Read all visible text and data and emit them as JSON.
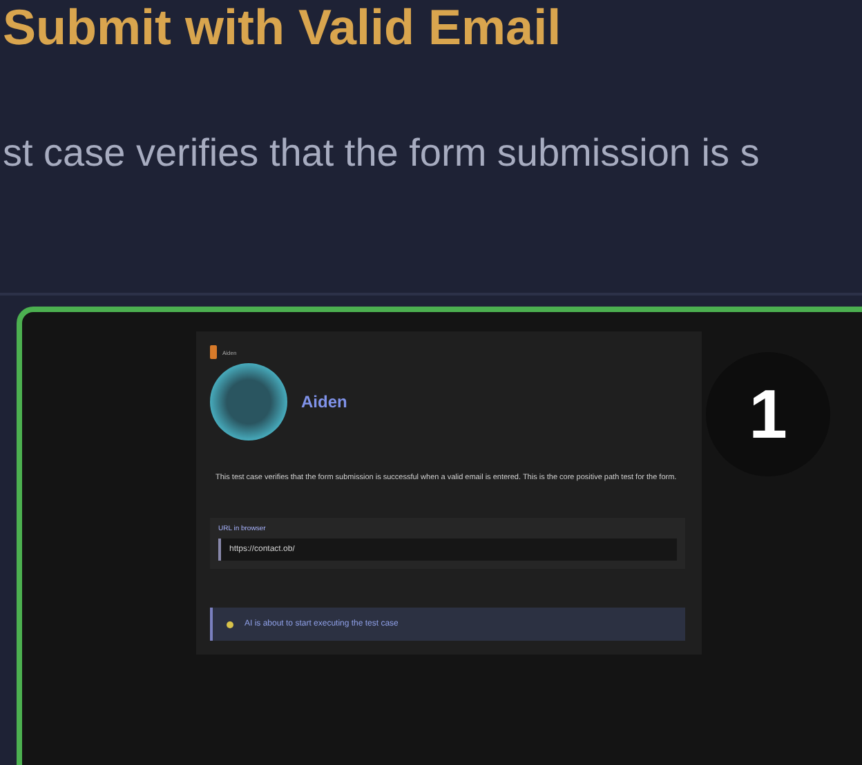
{
  "header": {
    "title": "Submit with Valid Email",
    "description": "st case verifies that the form submission is s"
  },
  "preview": {
    "highlighted": true,
    "step_number": "1",
    "card": {
      "brand": "Aiden",
      "agent_name": "Aiden",
      "description": "This test case verifies that the form submission is successful when a valid email is entered. This is the core positive path test for the form.",
      "field": {
        "label": "URL in browser",
        "value": "https://contact.ob/"
      },
      "notice": "AI is about to start executing the test case"
    }
  }
}
